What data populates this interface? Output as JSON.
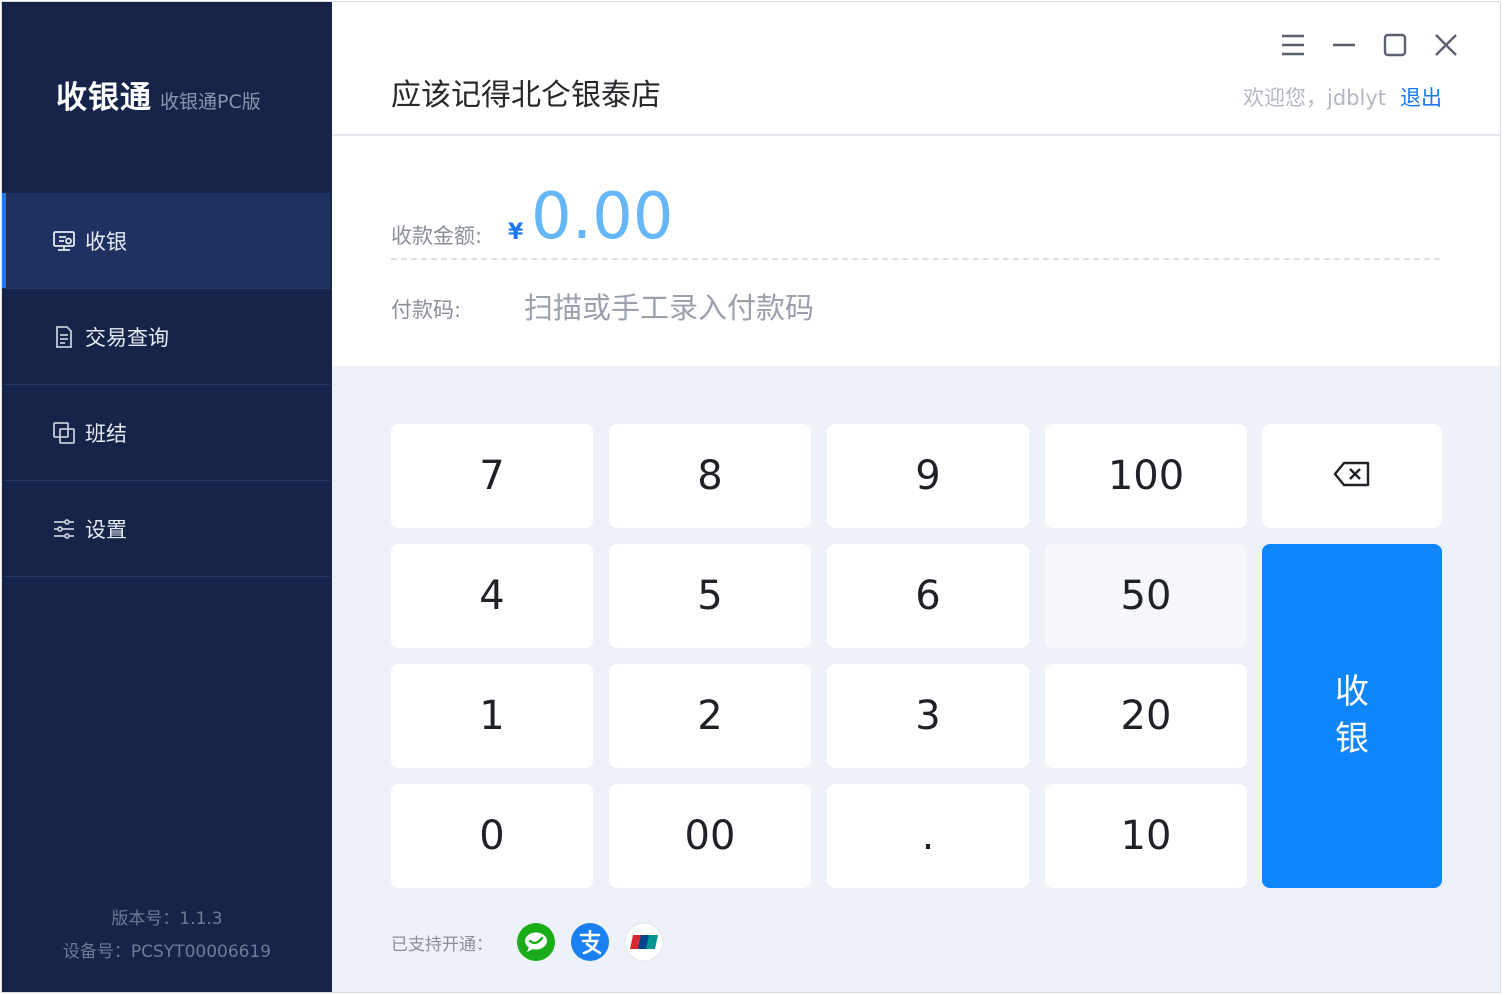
{
  "sidebar": {
    "brand": "收银通",
    "brand_sub": "收银通PC版",
    "items": [
      {
        "label": "收银",
        "icon": "cashier-icon"
      },
      {
        "label": "交易查询",
        "icon": "document-icon"
      },
      {
        "label": "班结",
        "icon": "shift-icon"
      },
      {
        "label": "设置",
        "icon": "sliders-icon"
      }
    ],
    "version": "版本号：1.1.3",
    "device": "设备号：PCSYT00006619"
  },
  "header": {
    "store_name": "应该记得北仑银泰店",
    "welcome": "欢迎您，jdblyt",
    "logout": "退出"
  },
  "payment": {
    "amount_label": "收款金额:",
    "currency": "¥",
    "amount": "0.00",
    "code_label": "付款码:",
    "code_placeholder": "扫描或手工录入付款码"
  },
  "keypad": {
    "k7": "7",
    "k8": "8",
    "k9": "9",
    "k100": "100",
    "k4": "4",
    "k5": "5",
    "k6": "6",
    "k50": "50",
    "k1": "1",
    "k2": "2",
    "k3": "3",
    "k20": "20",
    "k0": "0",
    "k00": "00",
    "kdot": ".",
    "k10": "10",
    "submit_line1": "收",
    "submit_line2": "银"
  },
  "support": {
    "label": "已支持开通：",
    "methods": [
      "wechat-pay-icon",
      "alipay-icon",
      "unionpay-icon"
    ]
  },
  "colors": {
    "sidebar_bg": "#16244a",
    "accent": "#0f86fb",
    "amount": "#66b6fa",
    "keypad_bg": "#edf1f8"
  }
}
